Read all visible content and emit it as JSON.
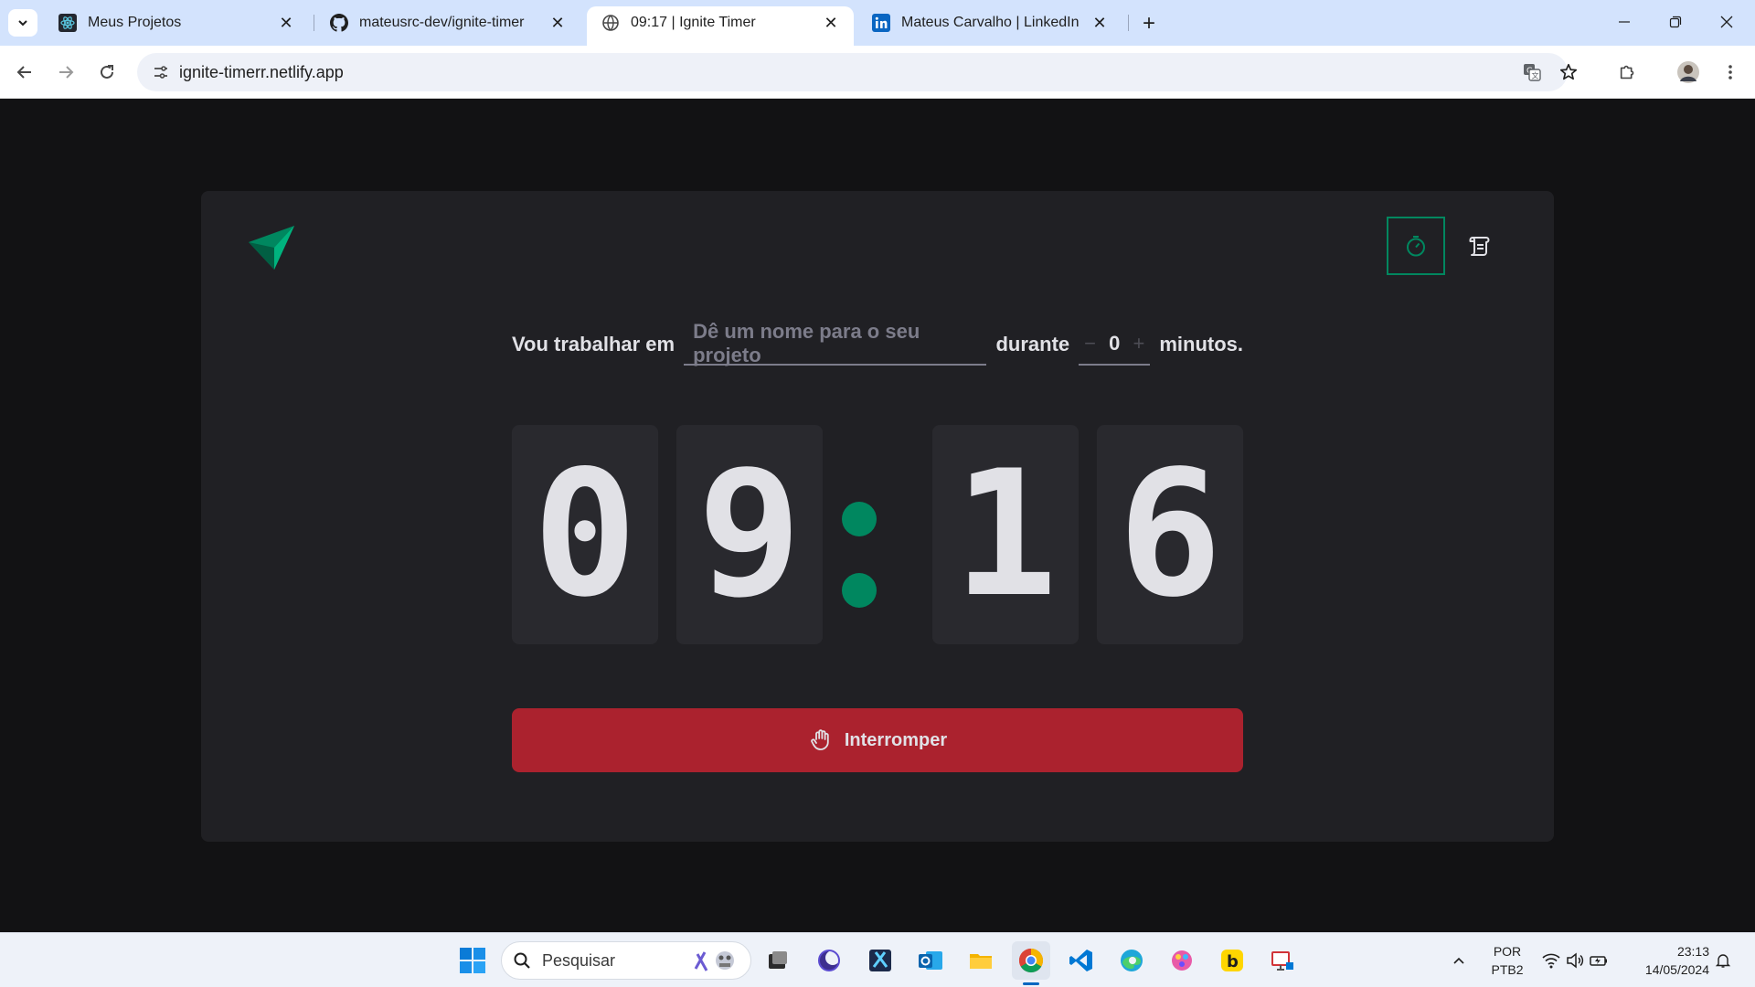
{
  "browser": {
    "tabs": [
      {
        "title": "Meus Projetos",
        "icon": "react-icon"
      },
      {
        "title": "mateusrc-dev/ignite-timer",
        "icon": "github-icon"
      },
      {
        "title": "09:17 | Ignite Timer",
        "icon": "globe-icon",
        "active": true
      },
      {
        "title": "Mateus Carvalho | LinkedIn",
        "icon": "linkedin-icon"
      }
    ],
    "url": "ignite-timerr.netlify.app"
  },
  "app": {
    "form": {
      "label_work": "Vou trabalhar em",
      "task_placeholder": "Dê um nome para o seu projeto",
      "label_during": "durante",
      "minus": "−",
      "minutes_value": "0",
      "plus": "+",
      "label_minutes": "minutos."
    },
    "countdown": {
      "min_tens": "0",
      "min_ones": "9",
      "separator": ":",
      "sec_tens": "1",
      "sec_ones": "6"
    },
    "stop_button_label": "Interromper",
    "accent_color": "#00875f",
    "danger_color": "#ab222e"
  },
  "taskbar": {
    "search_label": "Pesquisar",
    "lang_top": "POR",
    "lang_bottom": "PTB2",
    "time": "23:13",
    "date": "14/05/2024"
  }
}
